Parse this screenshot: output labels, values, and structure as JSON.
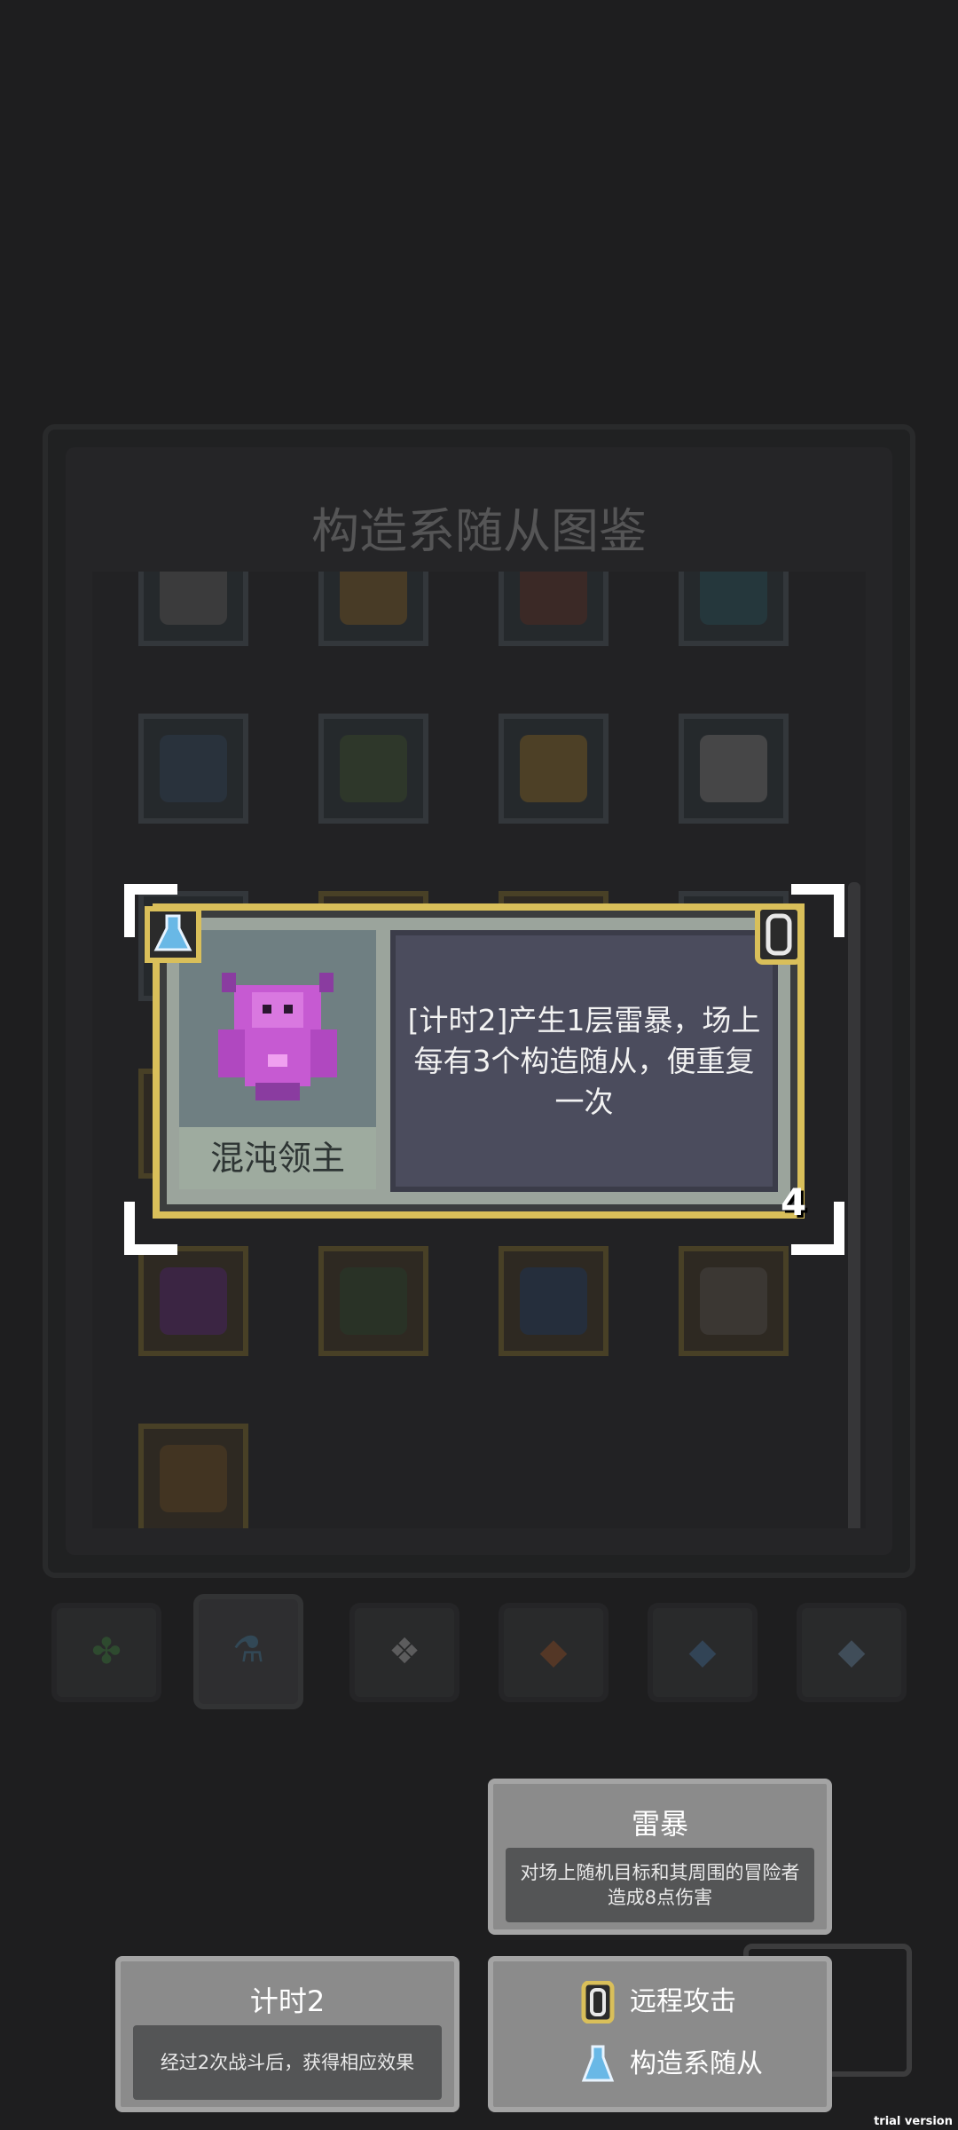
{
  "panel": {
    "title": "构造系随从图鉴"
  },
  "tabs": [
    {
      "icon": "clover-icon"
    },
    {
      "icon": "flask-icon"
    },
    {
      "icon": "gear-icon"
    },
    {
      "icon": "fox-icon"
    },
    {
      "icon": "gem-icon"
    },
    {
      "icon": "diamond-icon"
    }
  ],
  "card": {
    "name": "混沌领主",
    "description": "[计时2]产生1层雷暴，场上每有3个构造随从，便重复一次",
    "level": "4"
  },
  "tooltips": {
    "thunder": {
      "title": "雷暴",
      "body": "对场上随机目标和其周围的冒险者造成8点伤害"
    },
    "timer": {
      "title": "计时2",
      "body": "经过2次战斗后，获得相应效果"
    },
    "tags": [
      {
        "icon": "chain-link-icon",
        "label": "远程攻击"
      },
      {
        "icon": "flask-icon",
        "label": "构造系随从"
      }
    ]
  },
  "watermark": "trial version",
  "colors": {
    "card_border": "#d9bf5a",
    "portrait_bg": "#6f7f82",
    "desc_bg": "#4b4c5d",
    "accent_flask": "#69b8e6",
    "monster": "#c65ad2"
  }
}
